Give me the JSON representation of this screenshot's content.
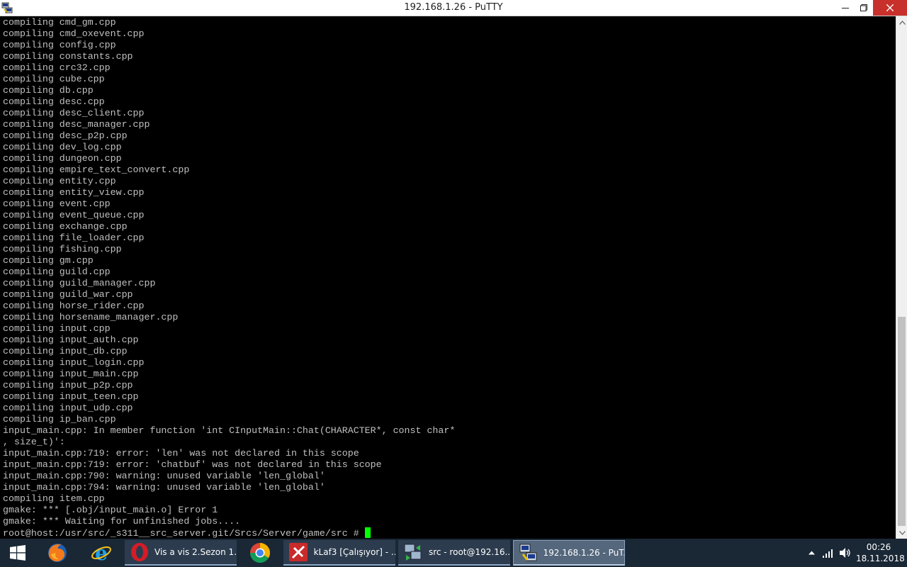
{
  "window": {
    "title": "192.168.1.26 - PuTTY",
    "icon": "putty-icon",
    "controls": [
      "minimize-icon",
      "restore-icon",
      "close-icon"
    ]
  },
  "terminal": {
    "lines": [
      "compiling cmd_gm.cpp",
      "compiling cmd_oxevent.cpp",
      "compiling config.cpp",
      "compiling constants.cpp",
      "compiling crc32.cpp",
      "compiling cube.cpp",
      "compiling db.cpp",
      "compiling desc.cpp",
      "compiling desc_client.cpp",
      "compiling desc_manager.cpp",
      "compiling desc_p2p.cpp",
      "compiling dev_log.cpp",
      "compiling dungeon.cpp",
      "compiling empire_text_convert.cpp",
      "compiling entity.cpp",
      "compiling entity_view.cpp",
      "compiling event.cpp",
      "compiling event_queue.cpp",
      "compiling exchange.cpp",
      "compiling file_loader.cpp",
      "compiling fishing.cpp",
      "compiling gm.cpp",
      "compiling guild.cpp",
      "compiling guild_manager.cpp",
      "compiling guild_war.cpp",
      "compiling horse_rider.cpp",
      "compiling horsename_manager.cpp",
      "compiling input.cpp",
      "compiling input_auth.cpp",
      "compiling input_db.cpp",
      "compiling input_login.cpp",
      "compiling input_main.cpp",
      "compiling input_p2p.cpp",
      "compiling input_teen.cpp",
      "compiling input_udp.cpp",
      "compiling ip_ban.cpp",
      "input_main.cpp: In member function 'int CInputMain::Chat(CHARACTER*, const char*",
      ", size_t)':",
      "input_main.cpp:719: error: 'len' was not declared in this scope",
      "input_main.cpp:719: error: 'chatbuf' was not declared in this scope",
      "input_main.cpp:790: warning: unused variable 'len_global'",
      "input_main.cpp:794: warning: unused variable 'len_global'",
      "compiling item.cpp",
      "gmake: *** [.obj/input_main.o] Error 1",
      "gmake: *** Waiting for unfinished jobs...."
    ],
    "prompt": "root@host:/usr/src/_s311__src_server.git/Srcs/Server/game/src # ",
    "cursor_color": "#00ff00",
    "text_color": "#c0c0c0"
  },
  "taskbar": {
    "start_icon": "windows-start-icon",
    "pinned": [
      {
        "name": "firefox-icon"
      },
      {
        "name": "internet-explorer-icon"
      }
    ],
    "tasks": [
      {
        "label": "Vis a vis 2.Sezon 1...",
        "icon": "opera-icon"
      },
      {
        "label": "",
        "icon": "chrome-icon"
      },
      {
        "label": "kLaf3 [Çalışıyor] - ...",
        "icon": "klaf-icon"
      },
      {
        "label": "src - root@192.16...",
        "icon": "winscp-icon"
      },
      {
        "label": "192.168.1.26 - PuT...",
        "icon": "putty-icon"
      }
    ],
    "tray_icons": [
      "chevron-up-icon",
      "signal-icon",
      "speaker-icon"
    ],
    "clock": {
      "time": "00:26",
      "date": "18.11.2018"
    }
  }
}
